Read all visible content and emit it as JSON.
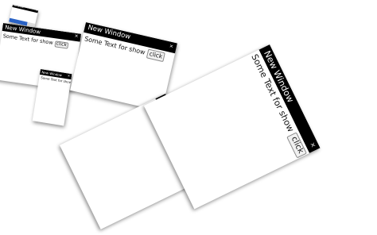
{
  "desktop": {
    "background": "#ffffff"
  },
  "window": {
    "title": "New Window",
    "close_glyph": "×",
    "body_text": "Some Text for show",
    "button_label": "click"
  },
  "colors": {
    "titlebar": "#000000",
    "title_text": "#ffffff",
    "window_bg": "#ffffff",
    "mini_accent": "#2b63c5"
  }
}
